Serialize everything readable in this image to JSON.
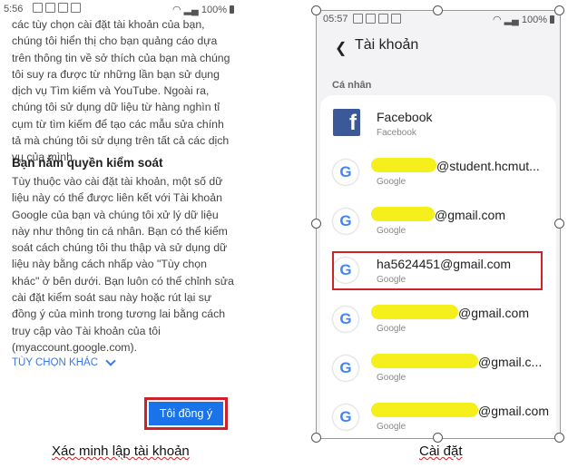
{
  "left": {
    "status": {
      "time": "5:56",
      "battery": "100%"
    },
    "paragraph1": "các tùy chọn cài đặt tài khoản của bạn, chúng tôi hiển thị cho bạn quảng cáo dựa trên thông tin về sở thích của bạn mà chúng tôi suy ra được từ những lần bạn sử dụng dịch vụ Tìm kiếm và YouTube. Ngoài ra, chúng tôi sử dụng dữ liệu từ hàng nghìn tỉ cụm từ tìm kiếm để tạo các mẫu sửa chính tả mà chúng tôi sử dụng trên tất cả các dịch vụ của mình.",
    "section_heading": "Bạn nắm quyền kiểm soát",
    "paragraph2": "Tùy thuộc vào cài đặt tài khoản, một số dữ liệu này có thể được liên kết với Tài khoản Google của bạn và chúng tôi xử lý dữ liệu này như thông tin cá nhân. Bạn có thể kiểm soát cách chúng tôi thu thập và sử dụng dữ liệu này bằng cách nhấp vào \"Tùy chọn khác\" ở bên dưới. Bạn luôn có thể chỉnh sửa cài đặt kiểm soát sau này hoặc rút lại sự đồng ý của mình trong tương lai bằng cách truy cập vào Tài khoản của tôi (myaccount.google.com).",
    "more_options": "TÙY CHỌN KHÁC",
    "agree_button": "Tôi đồng ý"
  },
  "right": {
    "status": {
      "time": "05:57",
      "battery": "100%"
    },
    "title": "Tài khoản",
    "section": "Cá nhân",
    "accounts": [
      {
        "name": "Facebook",
        "type": "Facebook",
        "icon": "facebook-icon"
      },
      {
        "name": "@student.hcmut...",
        "type": "Google",
        "icon": "google-icon"
      },
      {
        "name": "@gmail.com",
        "type": "Google",
        "icon": "google-icon"
      },
      {
        "name": "ha5624451@gmail.com",
        "type": "Google",
        "icon": "google-icon"
      },
      {
        "name": "@gmail.com",
        "type": "Google",
        "icon": "google-icon"
      },
      {
        "name": "@gmail.c...",
        "type": "Google",
        "icon": "google-icon"
      },
      {
        "name": "@gmail.com",
        "type": "Google",
        "icon": "google-icon"
      }
    ]
  },
  "captions": {
    "left": "Xác minh lập tài khoản",
    "right": "Cài đặt"
  },
  "colors": {
    "highlight": "#f5ef1c",
    "annotation_red": "#d0202a",
    "google_blue": "#1a73e8",
    "facebook": "#3b5998"
  }
}
